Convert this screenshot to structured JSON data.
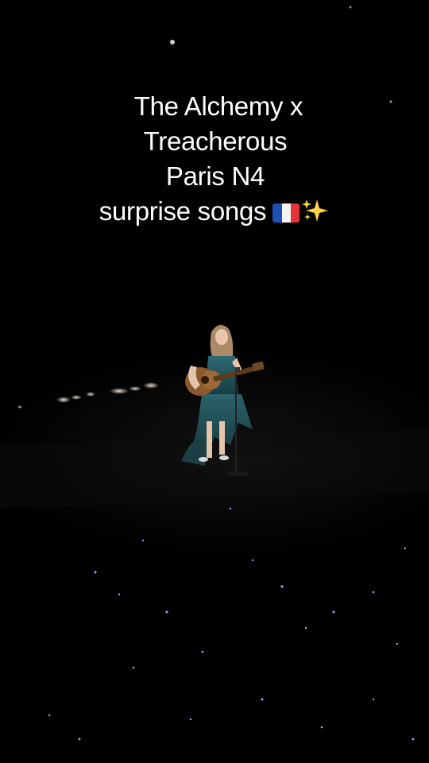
{
  "caption": {
    "line1": "The Alchemy x",
    "line2": "Treacherous",
    "line3": "Paris N4",
    "line4": "surprise songs"
  },
  "emoji": [
    "french-flag-icon",
    "sparkles-icon"
  ],
  "colors": {
    "background": "#000000",
    "text": "#ffffff",
    "dress": "#2a5a63",
    "guitar": "#8a5a2e"
  }
}
